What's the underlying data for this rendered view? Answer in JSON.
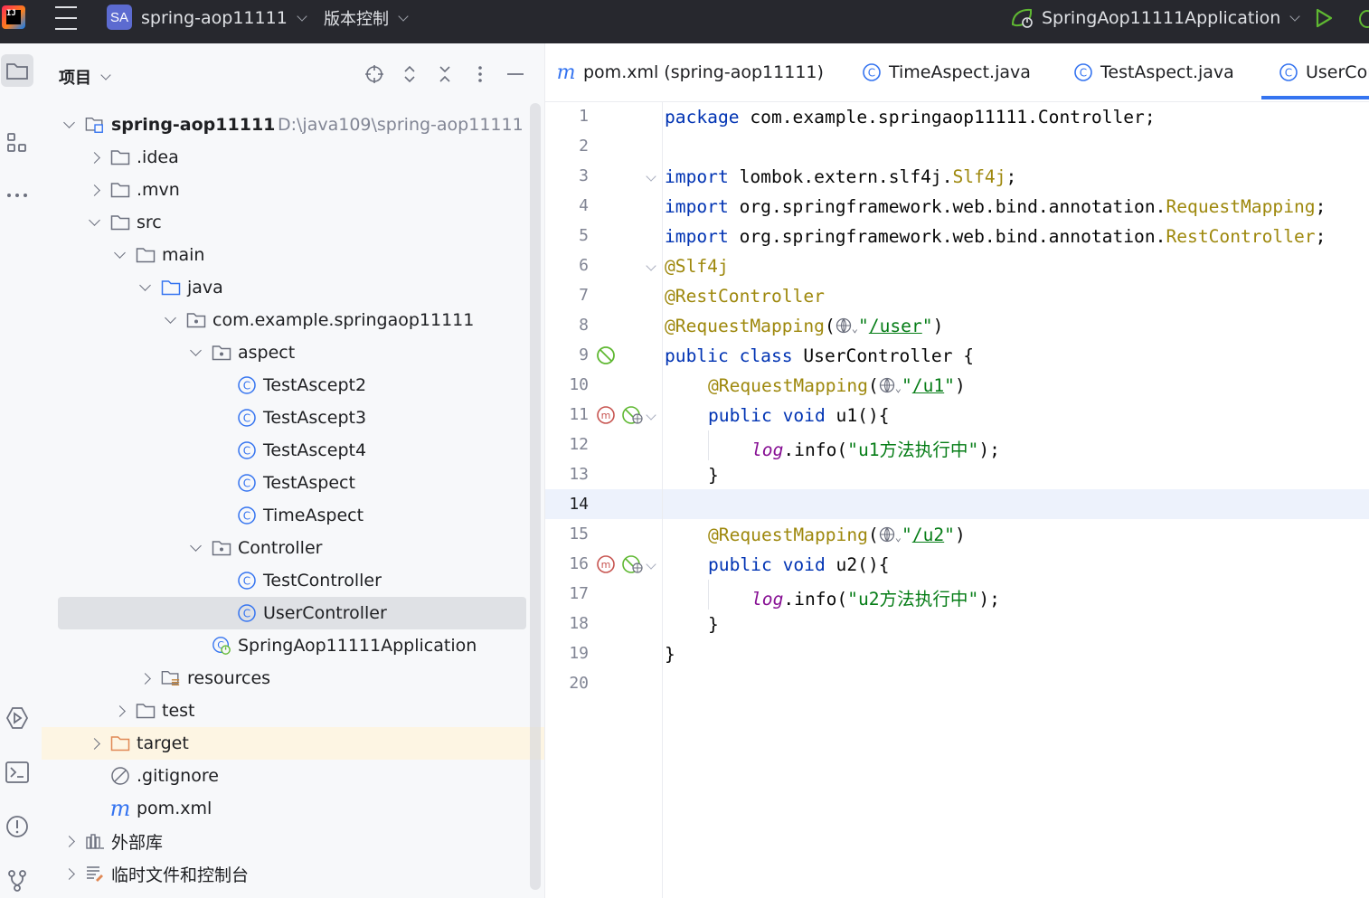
{
  "topbar": {
    "project_badge": "SA",
    "project_name": "spring-aop11111",
    "vcs_label": "版本控制",
    "run_config": "SpringAop11111Application"
  },
  "project_panel": {
    "title": "项目",
    "tree": [
      {
        "label": "spring-aop11111",
        "hint": "D:\\java109\\spring-aop11111",
        "icon": "module-folder-icon"
      },
      {
        "label": ".idea",
        "icon": "folder-icon"
      },
      {
        "label": ".mvn",
        "icon": "folder-icon"
      },
      {
        "label": "src",
        "icon": "folder-icon"
      },
      {
        "label": "main",
        "icon": "folder-icon"
      },
      {
        "label": "java",
        "icon": "source-folder-icon"
      },
      {
        "label": "com.example.springaop11111",
        "icon": "package-icon"
      },
      {
        "label": "aspect",
        "icon": "package-icon"
      },
      {
        "label": "TestAscept2",
        "icon": "class-icon"
      },
      {
        "label": "TestAscept3",
        "icon": "class-icon"
      },
      {
        "label": "TestAscept4",
        "icon": "class-icon"
      },
      {
        "label": "TestAspect",
        "icon": "class-icon"
      },
      {
        "label": "TimeAspect",
        "icon": "class-icon"
      },
      {
        "label": "Controller",
        "icon": "package-icon"
      },
      {
        "label": "TestController",
        "icon": "class-icon"
      },
      {
        "label": "UserController",
        "icon": "class-icon"
      },
      {
        "label": "SpringAop11111Application",
        "icon": "spring-boot-class-icon"
      },
      {
        "label": "resources",
        "icon": "resources-folder-icon"
      },
      {
        "label": "test",
        "icon": "folder-icon"
      },
      {
        "label": "target",
        "icon": "excluded-folder-icon"
      },
      {
        "label": ".gitignore",
        "icon": "ignored-file-icon"
      },
      {
        "label": "pom.xml",
        "icon": "maven-icon"
      },
      {
        "label": "外部库",
        "icon": "library-icon"
      },
      {
        "label": "临时文件和控制台",
        "icon": "scratches-icon"
      }
    ]
  },
  "editor": {
    "tabs": [
      {
        "label": "pom.xml (spring-aop11111)",
        "icon": "maven-icon"
      },
      {
        "label": "TimeAspect.java",
        "icon": "class-icon"
      },
      {
        "label": "TestAspect.java",
        "icon": "class-icon"
      },
      {
        "label": "UserCor",
        "icon": "class-icon",
        "active": true
      }
    ],
    "line_numbers": [
      "1",
      "2",
      "3",
      "4",
      "5",
      "6",
      "7",
      "8",
      "9",
      "10",
      "11",
      "12",
      "13",
      "14",
      "15",
      "16",
      "17",
      "18",
      "19",
      "20"
    ],
    "current_line": "14",
    "code": {
      "l1_kw": "package",
      "l1_rest": " com.example.springaop11111.Controller;",
      "l3_kw": "import",
      "l3_rest": " lombok.extern.slf4j.",
      "l3_cls": "Slf4j",
      "l3_end": ";",
      "l4_kw": "import",
      "l4_rest": " org.springframework.web.bind.annotation.",
      "l4_cls": "RequestMapping",
      "l4_end": ";",
      "l5_kw": "import",
      "l5_rest": " org.springframework.web.bind.annotation.",
      "l5_cls": "RestController",
      "l5_end": ";",
      "l6_an": "@Slf4j",
      "l7_an": "@RestController",
      "l8_an": "@RequestMapping",
      "l8_open": "(",
      "l8_q1": "\"",
      "l8_path": "/user",
      "l8_q2": "\"",
      "l8_close": ")",
      "l9_kw1": "public",
      "l9_kw2": "class",
      "l9_rest": " UserController {",
      "l10_an": "@RequestMapping",
      "l10_open": "(",
      "l10_q1": "\"",
      "l10_path": "/u1",
      "l10_q2": "\"",
      "l10_close": ")",
      "l11_kw1": "public",
      "l11_kw2": "void",
      "l11_rest": " u1(){",
      "l12_fld": "log",
      "l12_mid": ".info(",
      "l12_str": "\"u1方法执行中\"",
      "l12_end": ");",
      "l13": "}",
      "l15_an": "@RequestMapping",
      "l15_open": "(",
      "l15_q1": "\"",
      "l15_path": "/u2",
      "l15_q2": "\"",
      "l15_close": ")",
      "l16_kw1": "public",
      "l16_kw2": "void",
      "l16_rest": " u2(){",
      "l17_fld": "log",
      "l17_mid": ".info(",
      "l17_str": "\"u2方法执行中\"",
      "l17_end": ");",
      "l18": "}",
      "l19": "}"
    }
  },
  "colors": {
    "keyword": "#0033b3",
    "annotation": "#9e880d",
    "string": "#067d17",
    "field": "#871094",
    "accent": "#3574f0",
    "topbar_bg": "#27282e"
  }
}
